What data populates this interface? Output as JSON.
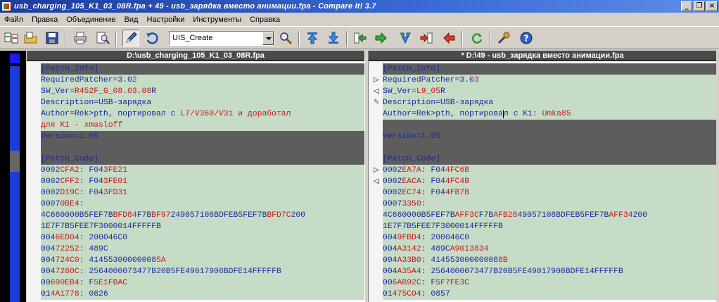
{
  "window": {
    "title": "usb_charging_105_K1_03_08R.fpa + 49 - usb_зарядка вместо анимации.fpa - Compare It! 3.7",
    "minimize": "_",
    "restore": "❐",
    "close": "×"
  },
  "menu": [
    "Файл",
    "Правка",
    "Объединение",
    "Вид",
    "Настройки",
    "Инструменты",
    "Справка"
  ],
  "toolbar": {
    "combo_value": "UIS_Create",
    "icons": [
      "compare-icon",
      "open-folder-icon",
      "save-icon",
      "print-icon",
      "print-preview-icon",
      "edit-pencil-icon",
      "undo-icon",
      "search-icon",
      "prev-diff-icon",
      "next-diff-icon",
      "copy-right-icon",
      "copy-right-all-icon",
      "merge-down-icon",
      "copy-left-icon",
      "copy-left-all-icon",
      "refresh-icon",
      "tools-icon",
      "help-icon"
    ]
  },
  "colors": {
    "same_line": "#c6dcc6",
    "section_line": "#5d5d5d",
    "text_blue": "#1c2a9e",
    "diff_red": "#c51b1b"
  },
  "left": {
    "header": "D:\\usb_charging_105_K1_03_08R.fpa",
    "lines": [
      {
        "style": "d",
        "parts": [
          [
            "k",
            "[Patch_Info]"
          ]
        ]
      },
      {
        "style": "g",
        "parts": [
          [
            "k",
            "RequiredPatcher=3.0"
          ],
          [
            "r",
            "2"
          ]
        ]
      },
      {
        "style": "g",
        "parts": [
          [
            "k",
            "SW_Ver="
          ],
          [
            "r",
            "R452F_G_08.03.08"
          ],
          [
            "k",
            "R"
          ]
        ]
      },
      {
        "style": "g",
        "parts": [
          [
            "k",
            "Description=USB-зарядка"
          ]
        ]
      },
      {
        "style": "g",
        "parts": [
          [
            "k",
            "Author=Rek>pth, портировал с "
          ],
          [
            "r",
            "L7/V360/V3i и доработал"
          ]
        ]
      },
      {
        "style": "g",
        "parts": [
          [
            "r",
            "для K1 - xmasloff"
          ]
        ]
      },
      {
        "style": "d",
        "parts": [
          [
            "k",
            "Version=1.05"
          ]
        ]
      },
      {
        "style": "d",
        "parts": [
          [
            "k",
            ""
          ]
        ]
      },
      {
        "style": "d",
        "parts": [
          [
            "k",
            "[Patch_Code]"
          ]
        ]
      },
      {
        "style": "g",
        "parts": [
          [
            "k",
            "0002"
          ],
          [
            "r",
            "CFA2"
          ],
          [
            "k",
            ": F04"
          ],
          [
            "r",
            "3FE21"
          ]
        ]
      },
      {
        "style": "g",
        "parts": [
          [
            "k",
            "0002"
          ],
          [
            "r",
            "CFF2"
          ],
          [
            "k",
            ": F04"
          ],
          [
            "r",
            "3FE01"
          ]
        ]
      },
      {
        "style": "g",
        "parts": [
          [
            "k",
            "0002"
          ],
          [
            "r",
            "D19C"
          ],
          [
            "k",
            ": F04"
          ],
          [
            "r",
            "3FD31"
          ]
        ]
      },
      {
        "style": "g",
        "parts": [
          [
            "k",
            "0007"
          ],
          [
            "r",
            "0BE4"
          ],
          [
            "k",
            ":"
          ]
        ]
      },
      {
        "style": "g",
        "parts": [
          [
            "k",
            "4C660000B5FEF7B"
          ],
          [
            "r",
            "BFD84"
          ],
          [
            "k",
            "F7B"
          ],
          [
            "r",
            "BF97"
          ],
          [
            "k",
            "249057108BDFEB5FEF7B"
          ],
          [
            "r",
            "BFD7C"
          ],
          [
            "k",
            "200"
          ]
        ]
      },
      {
        "style": "g",
        "parts": [
          [
            "k",
            "1E7F7B5FEE7F3000014FFFFFB"
          ]
        ]
      },
      {
        "style": "g",
        "parts": [
          [
            "k",
            "004"
          ],
          [
            "r",
            "6ED04"
          ],
          [
            "k",
            ": 200046C0"
          ]
        ]
      },
      {
        "style": "g",
        "parts": [
          [
            "k",
            "004"
          ],
          [
            "r",
            "72252"
          ],
          [
            "k",
            ": 489C"
          ]
        ]
      },
      {
        "style": "g",
        "parts": [
          [
            "k",
            "004"
          ],
          [
            "r",
            "724C0"
          ],
          [
            "k",
            ": 41455300000008"
          ],
          [
            "r",
            "5A"
          ]
        ]
      },
      {
        "style": "g",
        "parts": [
          [
            "k",
            "004"
          ],
          [
            "r",
            "7260C"
          ],
          [
            "k",
            ": 2564000073477B20B5FE49017908BDFE14FFFFFB"
          ]
        ]
      },
      {
        "style": "g",
        "parts": [
          [
            "k",
            "00"
          ],
          [
            "r",
            "690EB4"
          ],
          [
            "k",
            ": F"
          ],
          [
            "r",
            "5E1FBAC"
          ]
        ]
      },
      {
        "style": "g",
        "parts": [
          [
            "k",
            "01"
          ],
          [
            "r",
            "4A1778"
          ],
          [
            "k",
            ": 0826"
          ]
        ]
      }
    ],
    "gutter": []
  },
  "right": {
    "header": "* D:\\49 - usb_зарядка вместо анимации.fpa",
    "lines": [
      {
        "style": "d",
        "parts": [
          [
            "k",
            "[Patch_Info]"
          ]
        ]
      },
      {
        "style": "g",
        "parts": [
          [
            "k",
            "RequiredPatcher=3.0"
          ],
          [
            "r",
            "3"
          ]
        ]
      },
      {
        "style": "g",
        "parts": [
          [
            "k",
            "SW_Ver="
          ],
          [
            "r",
            "L9_05"
          ],
          [
            "k",
            "R"
          ]
        ]
      },
      {
        "style": "g",
        "parts": [
          [
            "k",
            "Description=USB-зарядка"
          ]
        ]
      },
      {
        "style": "g",
        "parts": [
          [
            "k",
            "Author=Rek>pth, портирова"
          ],
          [
            "cur",
            "л"
          ],
          [
            "k",
            " с K1: "
          ],
          [
            "r",
            "Umka85"
          ]
        ]
      },
      {
        "style": "d",
        "parts": [
          [
            "k",
            ""
          ]
        ]
      },
      {
        "style": "d",
        "parts": [
          [
            "k",
            "Version=1.05"
          ]
        ]
      },
      {
        "style": "d",
        "parts": [
          [
            "k",
            ""
          ]
        ]
      },
      {
        "style": "d",
        "parts": [
          [
            "k",
            "[Patch_Code]"
          ]
        ]
      },
      {
        "style": "g",
        "parts": [
          [
            "k",
            "0002"
          ],
          [
            "r",
            "EA7A"
          ],
          [
            "k",
            ": F04"
          ],
          [
            "r",
            "4FC6B"
          ]
        ]
      },
      {
        "style": "g",
        "parts": [
          [
            "k",
            "0002"
          ],
          [
            "r",
            "EACA"
          ],
          [
            "k",
            ": F04"
          ],
          [
            "r",
            "4FC4B"
          ]
        ]
      },
      {
        "style": "g",
        "parts": [
          [
            "k",
            "0002"
          ],
          [
            "r",
            "EC74"
          ],
          [
            "k",
            ": F04"
          ],
          [
            "r",
            "4FB7B"
          ]
        ]
      },
      {
        "style": "g",
        "parts": [
          [
            "k",
            "0007"
          ],
          [
            "r",
            "3350"
          ],
          [
            "k",
            ":"
          ]
        ]
      },
      {
        "style": "g",
        "parts": [
          [
            "k",
            "4C660000B5FEF7B"
          ],
          [
            "r",
            "AFF3C"
          ],
          [
            "k",
            "F7B"
          ],
          [
            "r",
            "AFB28"
          ],
          [
            "k",
            "49057108BDFEB5FEF7B"
          ],
          [
            "r",
            "AFF34"
          ],
          [
            "k",
            "200"
          ]
        ]
      },
      {
        "style": "g",
        "parts": [
          [
            "k",
            "1E7F7B5FEE7F3000014FFFFFB"
          ]
        ]
      },
      {
        "style": "g",
        "parts": [
          [
            "k",
            "004"
          ],
          [
            "r",
            "9FBD4"
          ],
          [
            "k",
            ": 200046C0"
          ]
        ]
      },
      {
        "style": "g",
        "parts": [
          [
            "k",
            "004"
          ],
          [
            "r",
            "A3142"
          ],
          [
            "k",
            ": 489C"
          ],
          [
            "r",
            "A9013834"
          ]
        ]
      },
      {
        "style": "g",
        "parts": [
          [
            "k",
            "004"
          ],
          [
            "r",
            "A33B0"
          ],
          [
            "k",
            ": 41455300000008"
          ],
          [
            "r",
            "8B"
          ]
        ]
      },
      {
        "style": "g",
        "parts": [
          [
            "k",
            "004"
          ],
          [
            "r",
            "A35A4"
          ],
          [
            "k",
            ": 2564000073477B20B5FE49017908BDFE14FFFFFB"
          ]
        ]
      },
      {
        "style": "g",
        "parts": [
          [
            "k",
            "00"
          ],
          [
            "r",
            "6AB92C"
          ],
          [
            "k",
            ": F"
          ],
          [
            "r",
            "5F7FE3C"
          ]
        ]
      },
      {
        "style": "g",
        "parts": [
          [
            "k",
            "01"
          ],
          [
            "r",
            "475C04"
          ],
          [
            "k",
            ": 0857"
          ]
        ]
      }
    ],
    "gutter": [
      {
        "row": 1,
        "mark": "▷"
      },
      {
        "row": 2,
        "mark": "◁"
      },
      {
        "row": 3,
        "mark": "✎"
      },
      {
        "row": 9,
        "mark": "▷"
      },
      {
        "row": 10,
        "mark": "◁"
      }
    ]
  }
}
